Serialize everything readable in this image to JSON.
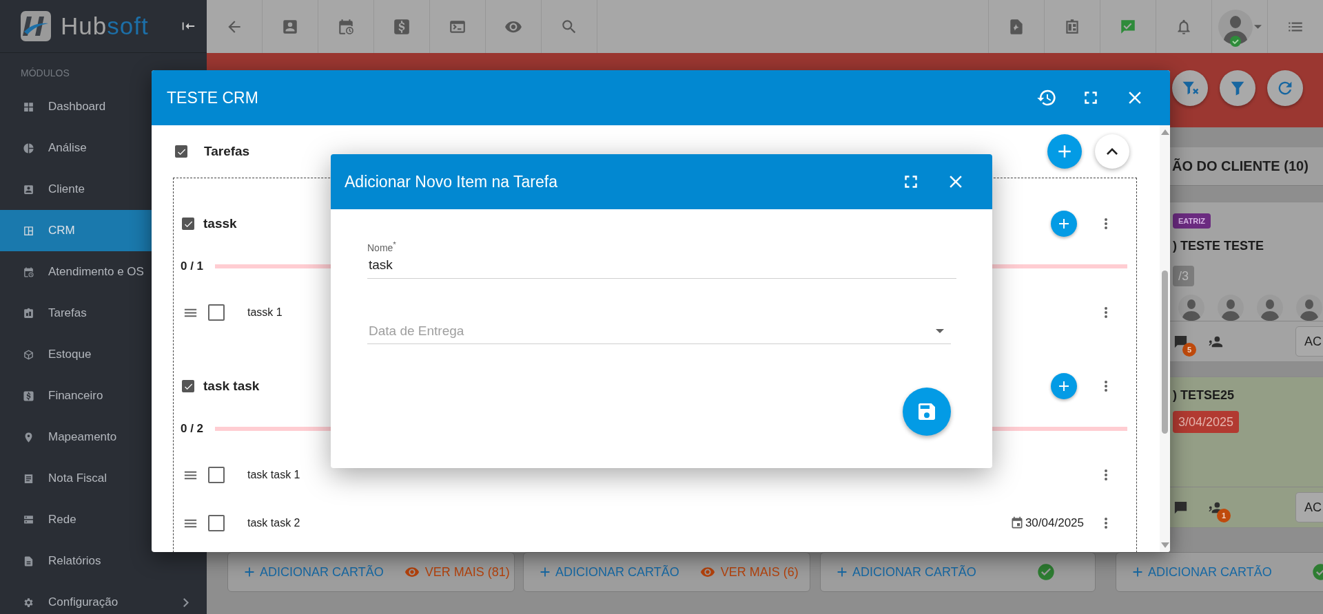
{
  "sidebar": {
    "logo": {
      "text": "Hub",
      "accent": "soft"
    },
    "section": "MÓDULOS",
    "items": [
      {
        "label": "Dashboard",
        "selected": false
      },
      {
        "label": "Análise",
        "selected": false
      },
      {
        "label": "Cliente",
        "selected": false
      },
      {
        "label": "CRM",
        "selected": true
      },
      {
        "label": "Atendimento e OS",
        "selected": false
      },
      {
        "label": "Tarefas",
        "selected": false
      },
      {
        "label": "Estoque",
        "selected": false
      },
      {
        "label": "Financeiro",
        "selected": false
      },
      {
        "label": "Mapeamento",
        "selected": false
      },
      {
        "label": "Nota Fiscal",
        "selected": false
      },
      {
        "label": "Rede",
        "selected": false
      },
      {
        "label": "Relatórios",
        "selected": false
      },
      {
        "label": "Configuração",
        "selected": false
      }
    ]
  },
  "toolbar": {
    "user": {
      "online": true
    }
  },
  "board": {
    "columns": [
      {
        "footer": {
          "add": "ADICIONAR CARTÃO",
          "kind": "more",
          "more": "VER MAIS (81)"
        }
      },
      {
        "footer": {
          "add": "ADICIONAR CARTÃO",
          "kind": "more",
          "more": "VER MAIS (6)"
        }
      },
      {
        "footer": {
          "add": "ADICIONAR CARTÃO",
          "kind": "done"
        }
      },
      {
        "title": "ÃO DO CLIENTE (10)",
        "cards": [
          {
            "tag": {
              "text": "EATRIZ",
              "color": "#6b2b80"
            },
            "title": ") TESTE TESTE",
            "badge": "/3",
            "members": [
              {
                "kind": "avatar"
              },
              {
                "kind": "avatar"
              },
              {
                "kind": "avatar"
              },
              {
                "kind": "avatar"
              }
            ],
            "highlighted": false,
            "comment_count": "5",
            "action": "AC"
          },
          {
            "title": ") TETSE25",
            "due": "3/04/2025",
            "highlighted": true,
            "assignee_count": "1",
            "action": "AC"
          }
        ],
        "footer": {
          "add": "ADICIONAR CARTÃO",
          "kind": "done"
        }
      }
    ]
  },
  "crm_dialog": {
    "title": "TESTE CRM",
    "section": {
      "label": "Tarefas",
      "checked": true,
      "expanded": true
    },
    "tasks": [
      {
        "name": "tassk",
        "checked": true,
        "progress": "0 / 1",
        "level": 0,
        "items": [
          {
            "name": "tassk 1",
            "checked": false
          }
        ]
      },
      {
        "name": "task task",
        "checked": true,
        "progress": "0 / 2",
        "level": 0,
        "items": [
          {
            "name": "task task 1",
            "checked": false
          },
          {
            "name": "task task 2",
            "checked": false,
            "due": "30/04/2025"
          }
        ]
      }
    ]
  },
  "item_dialog": {
    "title": "Adicionar Novo Item na Tarefa",
    "fields": [
      {
        "kind": "text",
        "label": "Nome$^{*}$",
        "value": "task"
      },
      {
        "kind": "select",
        "placeholder": "Data de Entrega"
      }
    ]
  }
}
